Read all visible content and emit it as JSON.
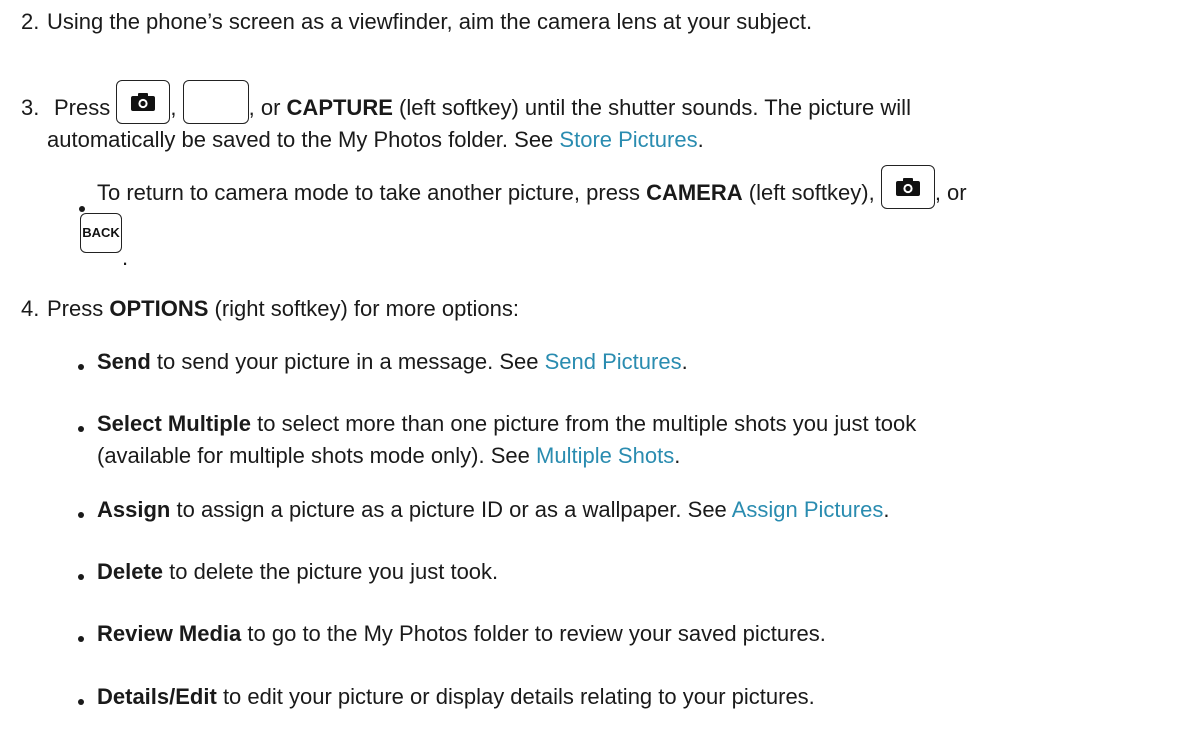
{
  "step2": {
    "number": "2.",
    "text": "Using the phone’s screen as a viewfinder, aim the camera lens at your subject."
  },
  "step3": {
    "number": "3.",
    "press": "Press",
    "comma": ",",
    "or_prefix": ", or",
    "capture": "CAPTURE",
    "capture_rest": "(left softkey) until the shutter sounds. The picture will",
    "line2_text": "automatically be saved to the My Photos folder. See",
    "link": "Store Pictures",
    "period": ".",
    "bullet": {
      "prefix": "To return to camera mode to take another picture, press",
      "camera": "CAMERA",
      "middle": "(left softkey),",
      "or": ", or",
      "back_key": "BACK",
      "period": "."
    }
  },
  "step4": {
    "number": "4.",
    "press": "Press",
    "options": "OPTIONS",
    "rest": "(right softkey) for more options:",
    "items": [
      {
        "term": "Send",
        "text": "to send your picture in a message. See",
        "link": "Send Pictures",
        "period": "."
      },
      {
        "term": "Select Multiple",
        "text": "to select more than one picture from the multiple shots you just took",
        "line2": "(available for multiple shots mode only). See",
        "link": "Multiple Shots",
        "period": "."
      },
      {
        "term": "Assign",
        "text": "to assign a picture as a picture ID or as a wallpaper. See",
        "link": "Assign Pictures",
        "period": "."
      },
      {
        "term": "Delete",
        "text": "to delete the picture you just took."
      },
      {
        "term": "Review Media",
        "text": "to go to the My Photos folder to review your saved pictures."
      },
      {
        "term": "Details/Edit",
        "text": "to edit your picture or display details relating to your pictures."
      }
    ]
  },
  "icons": {
    "camera_key": "camera-key-icon",
    "blank_key": "blank-key-icon",
    "back_key": "back-key-icon"
  }
}
